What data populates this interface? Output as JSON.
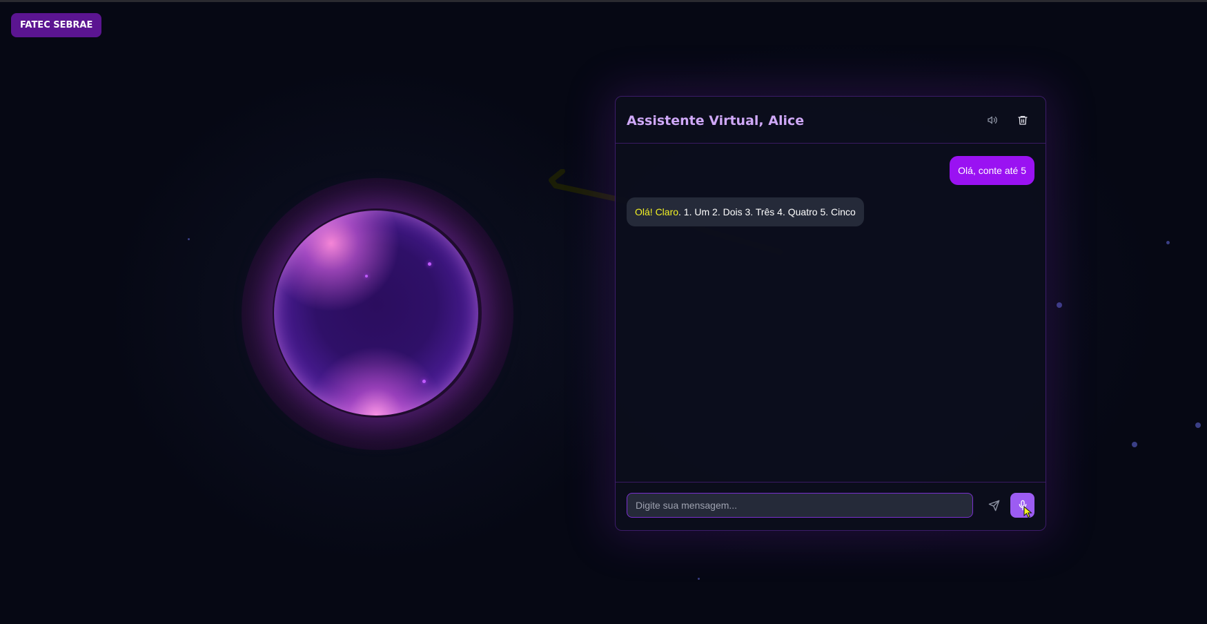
{
  "brand": {
    "label": "FATEC SEBRAE"
  },
  "chat": {
    "title": "Assistente Virtual, Alice",
    "header_icons": [
      "speaker-icon",
      "trash-icon"
    ],
    "messages": [
      {
        "role": "user",
        "text": "Olá, conte até 5"
      },
      {
        "role": "assistant",
        "highlight": "Olá! Claro",
        "text": ". 1. Um 2. Dois 3. Três 4. Quatro 5. Cinco"
      }
    ],
    "input": {
      "placeholder": "Digite sua mensagem...",
      "value": ""
    },
    "footer_icons": [
      "send-icon",
      "microphone-icon"
    ]
  },
  "colors": {
    "background": "#060814",
    "accent": "#9a12f2",
    "badge": "#5b1591",
    "title": "#cfa8f7",
    "mic_button": "#9c5cf2",
    "highlight": "#f4f224"
  }
}
